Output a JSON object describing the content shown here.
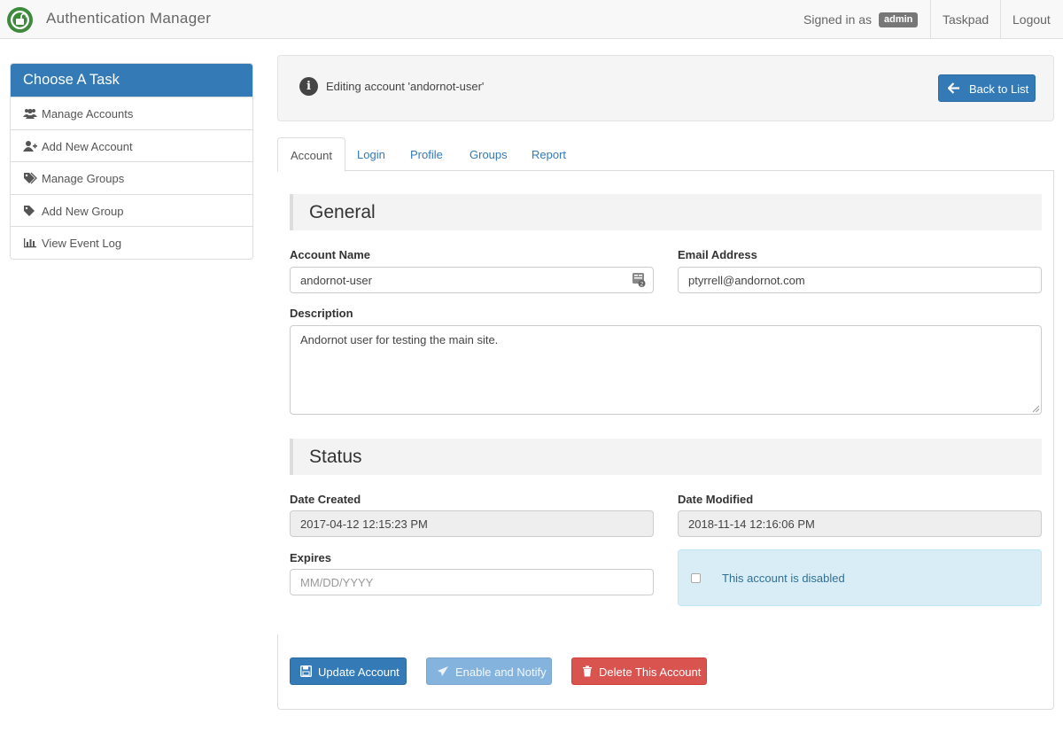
{
  "app": {
    "title": "Authentication Manager",
    "signed_in_label": "Signed in as",
    "username": "admin",
    "nav": [
      "Taskpad",
      "Logout"
    ]
  },
  "sidebar": {
    "heading": "Choose A Task",
    "items": [
      {
        "label": "Manage Accounts",
        "icon": "users-icon"
      },
      {
        "label": "Add New Account",
        "icon": "user-plus-icon"
      },
      {
        "label": "Manage Groups",
        "icon": "tags-icon"
      },
      {
        "label": "Add New Group",
        "icon": "tag-icon"
      },
      {
        "label": "View Event Log",
        "icon": "bar-chart-icon"
      }
    ]
  },
  "info": {
    "message": "Editing account 'andornot-user'",
    "back_button": "Back to List"
  },
  "tabs": [
    {
      "label": "Account",
      "active": true
    },
    {
      "label": "Login",
      "active": false
    },
    {
      "label": "Profile",
      "active": false
    },
    {
      "label": "Groups",
      "active": false
    },
    {
      "label": "Report",
      "active": false
    }
  ],
  "form": {
    "general_heading": "General",
    "account_name_label": "Account Name",
    "account_name_value": "andornot-user",
    "email_label": "Email Address",
    "email_value": "ptyrrell@andornot.com",
    "description_label": "Description",
    "description_value": "Andornot user for testing the main site.",
    "status_heading": "Status",
    "date_created_label": "Date Created",
    "date_created_value": "2017-04-12 12:15:23 PM",
    "date_modified_label": "Date Modified",
    "date_modified_value": "2018-11-14 12:16:06 PM",
    "expires_label": "Expires",
    "expires_placeholder": "MM/DD/YYYY",
    "disabled_label": "This account is disabled",
    "disabled_checked": false
  },
  "actions": {
    "update": "Update Account",
    "enable_notify": "Enable and Notify",
    "delete": "Delete This Account"
  },
  "colors": {
    "primary": "#337ab7",
    "danger": "#d9534f",
    "info_bg": "#d9edf7",
    "brand_green": "#3d8a3d"
  }
}
